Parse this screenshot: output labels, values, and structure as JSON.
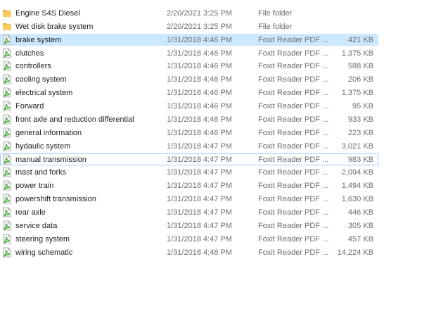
{
  "files": [
    {
      "name": "Engine S4S Diesel",
      "date": "2/20/2021 3:25 PM",
      "type": "File folder",
      "size": "",
      "icon": "folder-icon"
    },
    {
      "name": "Wet disk brake system",
      "date": "2/20/2021 3:25 PM",
      "type": "File folder",
      "size": "",
      "icon": "folder-icon"
    },
    {
      "name": "brake system",
      "date": "1/31/2018 4:46 PM",
      "type": "Foxit Reader PDF ...",
      "size": "421 KB",
      "icon": "pdf-file-icon",
      "state": "selected"
    },
    {
      "name": "clutches",
      "date": "1/31/2018 4:46 PM",
      "type": "Foxit Reader PDF ...",
      "size": "1,375 KB",
      "icon": "pdf-file-icon"
    },
    {
      "name": "controllers",
      "date": "1/31/2018 4:46 PM",
      "type": "Foxit Reader PDF ...",
      "size": "588 KB",
      "icon": "pdf-file-icon"
    },
    {
      "name": "cooling system",
      "date": "1/31/2018 4:46 PM",
      "type": "Foxit Reader PDF ...",
      "size": "206 KB",
      "icon": "pdf-file-icon"
    },
    {
      "name": "electrical system",
      "date": "1/31/2018 4:46 PM",
      "type": "Foxit Reader PDF ...",
      "size": "1,375 KB",
      "icon": "pdf-file-icon"
    },
    {
      "name": "Forward",
      "date": "1/31/2018 4:46 PM",
      "type": "Foxit Reader PDF ...",
      "size": "95 KB",
      "icon": "pdf-file-icon"
    },
    {
      "name": "front axle and reduction differential",
      "date": "1/31/2018 4:46 PM",
      "type": "Foxit Reader PDF ...",
      "size": "933 KB",
      "icon": "pdf-file-icon"
    },
    {
      "name": "general information",
      "date": "1/31/2018 4:46 PM",
      "type": "Foxit Reader PDF ...",
      "size": "223 KB",
      "icon": "pdf-file-icon"
    },
    {
      "name": "hydaulic system",
      "date": "1/31/2018 4:47 PM",
      "type": "Foxit Reader PDF ...",
      "size": "3,021 KB",
      "icon": "pdf-file-icon"
    },
    {
      "name": "manual transmission",
      "date": "1/31/2018 4:47 PM",
      "type": "Foxit Reader PDF ...",
      "size": "983 KB",
      "icon": "pdf-file-icon",
      "state": "focused"
    },
    {
      "name": "mast and forks",
      "date": "1/31/2018 4:47 PM",
      "type": "Foxit Reader PDF ...",
      "size": "2,094 KB",
      "icon": "pdf-file-icon"
    },
    {
      "name": "power train",
      "date": "1/31/2018 4:47 PM",
      "type": "Foxit Reader PDF ...",
      "size": "1,494 KB",
      "icon": "pdf-file-icon"
    },
    {
      "name": "powershift transmission",
      "date": "1/31/2018 4:47 PM",
      "type": "Foxit Reader PDF ...",
      "size": "1,630 KB",
      "icon": "pdf-file-icon"
    },
    {
      "name": "rear axle",
      "date": "1/31/2018 4:47 PM",
      "type": "Foxit Reader PDF ...",
      "size": "446 KB",
      "icon": "pdf-file-icon"
    },
    {
      "name": "service data",
      "date": "1/31/2018 4:47 PM",
      "type": "Foxit Reader PDF ...",
      "size": "305 KB",
      "icon": "pdf-file-icon"
    },
    {
      "name": "steering system",
      "date": "1/31/2018 4:47 PM",
      "type": "Foxit Reader PDF ...",
      "size": "457 KB",
      "icon": "pdf-file-icon"
    },
    {
      "name": "wiring schematic",
      "date": "1/31/2018 4:48 PM",
      "type": "Foxit Reader PDF ...",
      "size": "14,224 KB",
      "icon": "pdf-file-icon"
    }
  ],
  "colors": {
    "selected_background": "#cce8ff",
    "focused_border": "#99d1ff",
    "folder": "#f6c452",
    "pdf_icon_accent": "#3fa535"
  }
}
